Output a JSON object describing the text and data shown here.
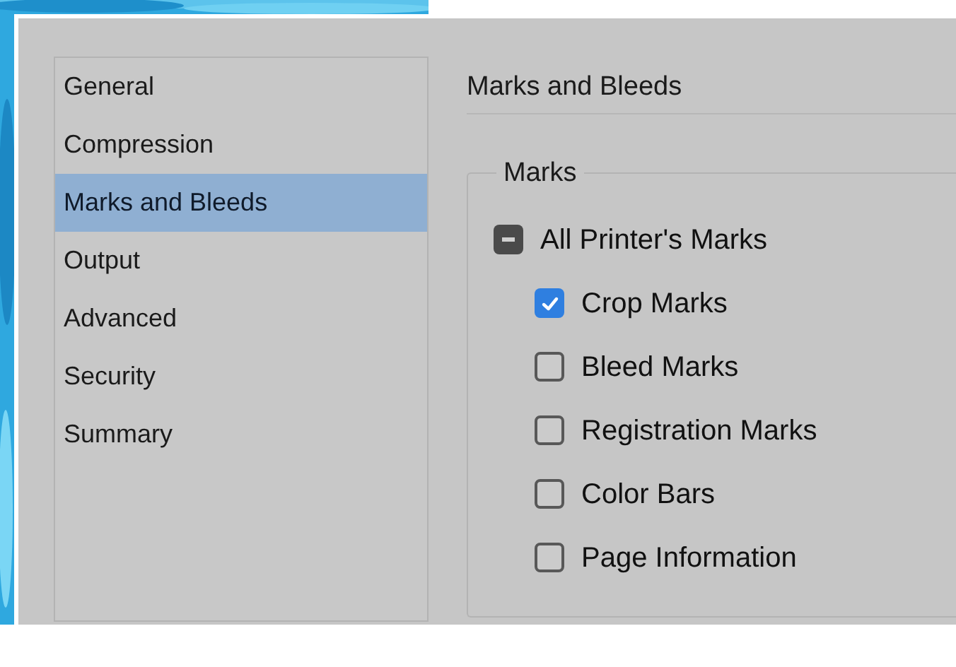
{
  "sidebar": {
    "items": [
      {
        "label": "General",
        "selected": false
      },
      {
        "label": "Compression",
        "selected": false
      },
      {
        "label": "Marks and Bleeds",
        "selected": true
      },
      {
        "label": "Output",
        "selected": false
      },
      {
        "label": "Advanced",
        "selected": false
      },
      {
        "label": "Security",
        "selected": false
      },
      {
        "label": "Summary",
        "selected": false
      }
    ]
  },
  "panel": {
    "title": "Marks and Bleeds",
    "group": {
      "legend": "Marks",
      "master": {
        "label": "All Printer's Marks",
        "indeterminate": true
      },
      "options": [
        {
          "label": "Crop Marks",
          "checked": true
        },
        {
          "label": "Bleed Marks",
          "checked": false
        },
        {
          "label": "Registration Marks",
          "checked": false
        },
        {
          "label": "Color Bars",
          "checked": false
        },
        {
          "label": "Page Information",
          "checked": false
        }
      ]
    }
  }
}
